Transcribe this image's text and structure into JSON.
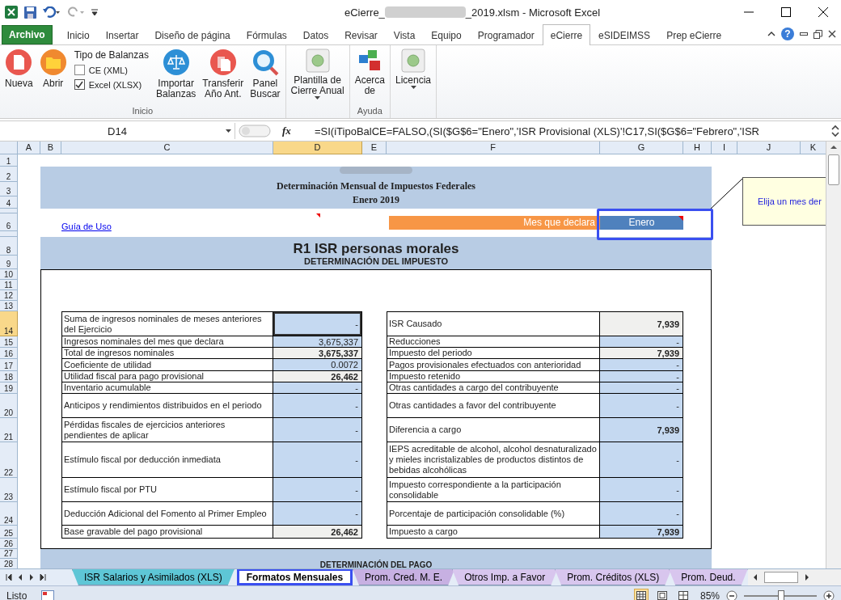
{
  "window": {
    "title_prefix": "eCierre_",
    "title_suffix": "_2019.xlsm  -  Microsoft Excel"
  },
  "ribbon_tabs": [
    {
      "label": "Archivo",
      "kind": "file",
      "selected": false
    },
    {
      "label": "Inicio",
      "kind": "tab",
      "selected": false
    },
    {
      "label": "Insertar",
      "kind": "tab",
      "selected": false
    },
    {
      "label": "Diseño de página",
      "kind": "tab",
      "selected": false
    },
    {
      "label": "Fórmulas",
      "kind": "tab",
      "selected": false
    },
    {
      "label": "Datos",
      "kind": "tab",
      "selected": false
    },
    {
      "label": "Revisar",
      "kind": "tab",
      "selected": false
    },
    {
      "label": "Vista",
      "kind": "tab",
      "selected": false
    },
    {
      "label": "Equipo",
      "kind": "tab",
      "selected": false
    },
    {
      "label": "Programador",
      "kind": "tab",
      "selected": false
    },
    {
      "label": "eCierre",
      "kind": "tab",
      "selected": true
    },
    {
      "label": "eSIDEIMSS",
      "kind": "tab",
      "selected": false
    },
    {
      "label": "Prep eCierre",
      "kind": "tab",
      "selected": false
    }
  ],
  "help_button": "?",
  "ribbon_groups": [
    {
      "label": "Inicio",
      "items": [
        {
          "kind": "button",
          "lines": [
            "Nueva"
          ],
          "has_menu": false
        },
        {
          "kind": "button",
          "lines": [
            "Abrir"
          ],
          "has_menu": false
        },
        {
          "kind": "checklist",
          "title": "Tipo de Balanzas",
          "options": [
            {
              "label": "CE (XML)",
              "checked": false
            },
            {
              "label": "Excel (XLSX)",
              "checked": true
            }
          ]
        },
        {
          "kind": "button",
          "lines": [
            "Importar",
            "Balanzas"
          ],
          "has_menu": false
        },
        {
          "kind": "button",
          "lines": [
            "Transferir",
            "Año Ant."
          ],
          "has_menu": false
        },
        {
          "kind": "button",
          "lines": [
            "Panel",
            "Buscar"
          ],
          "has_menu": false
        }
      ]
    },
    {
      "items": [
        {
          "kind": "button",
          "lines": [
            "Plantilla de",
            "Cierre Anual"
          ],
          "has_menu": true
        }
      ]
    },
    {
      "label": "Ayuda",
      "items": [
        {
          "kind": "button",
          "lines": [
            "Acerca",
            "de"
          ],
          "has_menu": false
        }
      ]
    },
    {
      "items": [
        {
          "kind": "button",
          "lines": [
            "Licencia"
          ],
          "has_menu": true
        }
      ]
    }
  ],
  "formula_bar": {
    "name_box": "D14",
    "function_label": "fx",
    "formula": "=SI(iTipoBalCE=FALSO,(SI($G$6=\"Enero\",'ISR Provisional (XLS)'!C17,SI($G$6=\"Febrero\",'ISR"
  },
  "columns": [
    {
      "label": "A",
      "selected": false
    },
    {
      "label": "B",
      "selected": false
    },
    {
      "label": "C",
      "selected": false
    },
    {
      "label": "D",
      "selected": true
    },
    {
      "label": "E",
      "selected": false
    },
    {
      "label": "F",
      "selected": false
    },
    {
      "label": "G",
      "selected": false
    },
    {
      "label": "H",
      "selected": false
    },
    {
      "label": "I",
      "selected": false
    },
    {
      "label": "J",
      "selected": false
    },
    {
      "label": "K",
      "selected": false
    }
  ],
  "rows": [
    {
      "label": "1",
      "selected": false
    },
    {
      "label": "2",
      "selected": false
    },
    {
      "label": "3",
      "selected": false
    },
    {
      "label": "4",
      "selected": false
    },
    {
      "selected": false
    },
    {
      "label": "6",
      "selected": false
    },
    {
      "selected": false
    },
    {
      "label": "8",
      "selected": false
    },
    {
      "label": "9",
      "selected": false
    },
    {
      "label": "10",
      "selected": false
    },
    {
      "label": "11",
      "selected": false
    },
    {
      "label": "12",
      "selected": false
    },
    {
      "label": "13",
      "selected": false
    },
    {
      "label": "14",
      "selected": true
    },
    {
      "label": "15",
      "selected": false
    },
    {
      "label": "16",
      "selected": false
    },
    {
      "label": "17",
      "selected": false
    },
    {
      "label": "18",
      "selected": false
    },
    {
      "label": "19",
      "selected": false
    },
    {
      "label": "20",
      "selected": false
    },
    {
      "label": "21",
      "selected": false
    },
    {
      "label": "22",
      "selected": false
    },
    {
      "label": "23",
      "selected": false
    },
    {
      "label": "24",
      "selected": false
    },
    {
      "label": "25",
      "selected": false
    },
    {
      "label": "26",
      "selected": false
    },
    {
      "label": "27",
      "selected": false
    },
    {
      "label": "28",
      "selected": false
    }
  ],
  "header": {
    "title": "Determinación Mensual de Impuestos Federales",
    "subtitle": "Enero 2019"
  },
  "guide_link": "Guía de Uso",
  "month_selector": {
    "label": "Mes que declara",
    "value": "Enero",
    "highlighted": true
  },
  "comment": "Elija un mes der",
  "section": {
    "title": "R1 ISR personas morales",
    "subtitle": "DETERMINACIÓN DEL IMPUESTO"
  },
  "left_table": [
    {
      "label": "Suma de ingresos nominales de meses anteriores del Ejercicio",
      "value": "-",
      "kind": "input",
      "bold": false,
      "selected": true
    },
    {
      "label": "Ingresos nominales del mes que declara",
      "value": "3,675,337",
      "kind": "input",
      "bold": false,
      "selected": false
    },
    {
      "label": "Total de ingresos nominales",
      "value": "3,675,337",
      "kind": "calculated",
      "bold": true,
      "selected": false
    },
    {
      "label": "Coeficiente de utilidad",
      "value": "0.0072",
      "kind": "input",
      "bold": false,
      "selected": false
    },
    {
      "label": "Utilidad fiscal para pago provisional",
      "value": "26,462",
      "kind": "calculated",
      "bold": true,
      "selected": false
    },
    {
      "label": "Inventario acumulable",
      "value": "-",
      "kind": "input",
      "bold": false,
      "selected": false
    },
    {
      "label": "Anticipos y rendimientos distribuidos en el periodo",
      "value": "-",
      "kind": "input",
      "bold": false,
      "selected": false
    },
    {
      "label": "Pérdidas fiscales de ejercicios anteriores pendientes de aplicar",
      "value": "-",
      "kind": "input",
      "bold": false,
      "selected": false
    },
    {
      "label": "Estímulo fiscal por deducción inmediata",
      "value": "-",
      "kind": "input",
      "bold": false,
      "selected": false
    },
    {
      "label": "Estímulo fiscal por PTU",
      "value": "-",
      "kind": "input",
      "bold": false,
      "selected": false
    },
    {
      "label": "Deducción Adicional del Fomento al Primer Empleo",
      "value": "-",
      "kind": "input",
      "bold": false,
      "selected": false
    },
    {
      "label": "Base gravable del pago provisional",
      "value": "26,462",
      "kind": "calculated",
      "bold": true,
      "selected": false
    }
  ],
  "right_table": [
    {
      "label": "ISR Causado",
      "value": "7,939",
      "kind": "calculated",
      "bold": true,
      "selected": false
    },
    {
      "label": "Reducciones",
      "value": "-",
      "kind": "input",
      "bold": false,
      "selected": false
    },
    {
      "label": "Impuesto del periodo",
      "value": "7,939",
      "kind": "calculated",
      "bold": true,
      "selected": false
    },
    {
      "label": "Pagos provisionales efectuados con anterioridad",
      "value": "-",
      "kind": "input",
      "bold": false,
      "selected": false
    },
    {
      "label": "Impuesto retenido",
      "value": "-",
      "kind": "input",
      "bold": false,
      "selected": false
    },
    {
      "label": "Otras cantidades a cargo del contribuyente",
      "value": "-",
      "kind": "input",
      "bold": false,
      "selected": false
    },
    {
      "label": "Otras cantidades a favor del contribuyente",
      "value": "-",
      "kind": "input",
      "bold": false,
      "selected": false
    },
    {
      "label": "Diferencia a cargo",
      "value": "7,939",
      "kind": "input",
      "bold": true,
      "selected": false
    },
    {
      "label": "IEPS acreditable de alcohol, alcohol desnaturalizado y mieles incristalizables de productos distintos de bebidas alcohólicas",
      "value": "-",
      "kind": "input",
      "bold": false,
      "selected": false
    },
    {
      "label": "Impuesto correspondiente a la participación consolidable",
      "value": "-",
      "kind": "input",
      "bold": false,
      "selected": false
    },
    {
      "label": "Porcentaje de participación consolidable (%)",
      "value": "-",
      "kind": "input",
      "bold": false,
      "selected": false
    },
    {
      "label": "Impuesto a cargo",
      "value": "7,939",
      "kind": "input",
      "bold": true,
      "selected": false
    }
  ],
  "next_section": "DETERMINACIÓN DEL PAGO",
  "sheet_tabs": [
    {
      "label": "ISR Salarios y Asimilados (XLS)",
      "color": "#5ec6d6",
      "selected": false,
      "highlighted": false
    },
    {
      "label": "Formatos Mensuales",
      "selected": true,
      "highlighted": true
    },
    {
      "label": "Prom. Cred. M. E.",
      "color": "#c7b0e2",
      "selected": false,
      "highlighted": false
    },
    {
      "label": "Otros Imp. a Favor",
      "color": "#d8c6ee",
      "selected": false,
      "highlighted": false
    },
    {
      "label": "Prom. Créditos (XLS)",
      "color": "#d8c6ee",
      "selected": false,
      "highlighted": false
    },
    {
      "label": "Prom. Deud.",
      "color": "#d8c6ee",
      "selected": false,
      "highlighted": false
    }
  ],
  "status_bar": {
    "status": "Listo",
    "views": [
      {
        "selected": true
      },
      {
        "selected": false
      },
      {
        "selected": false
      }
    ],
    "zoom": "85%",
    "zoom_slider": {
      "level": 0.5
    }
  }
}
